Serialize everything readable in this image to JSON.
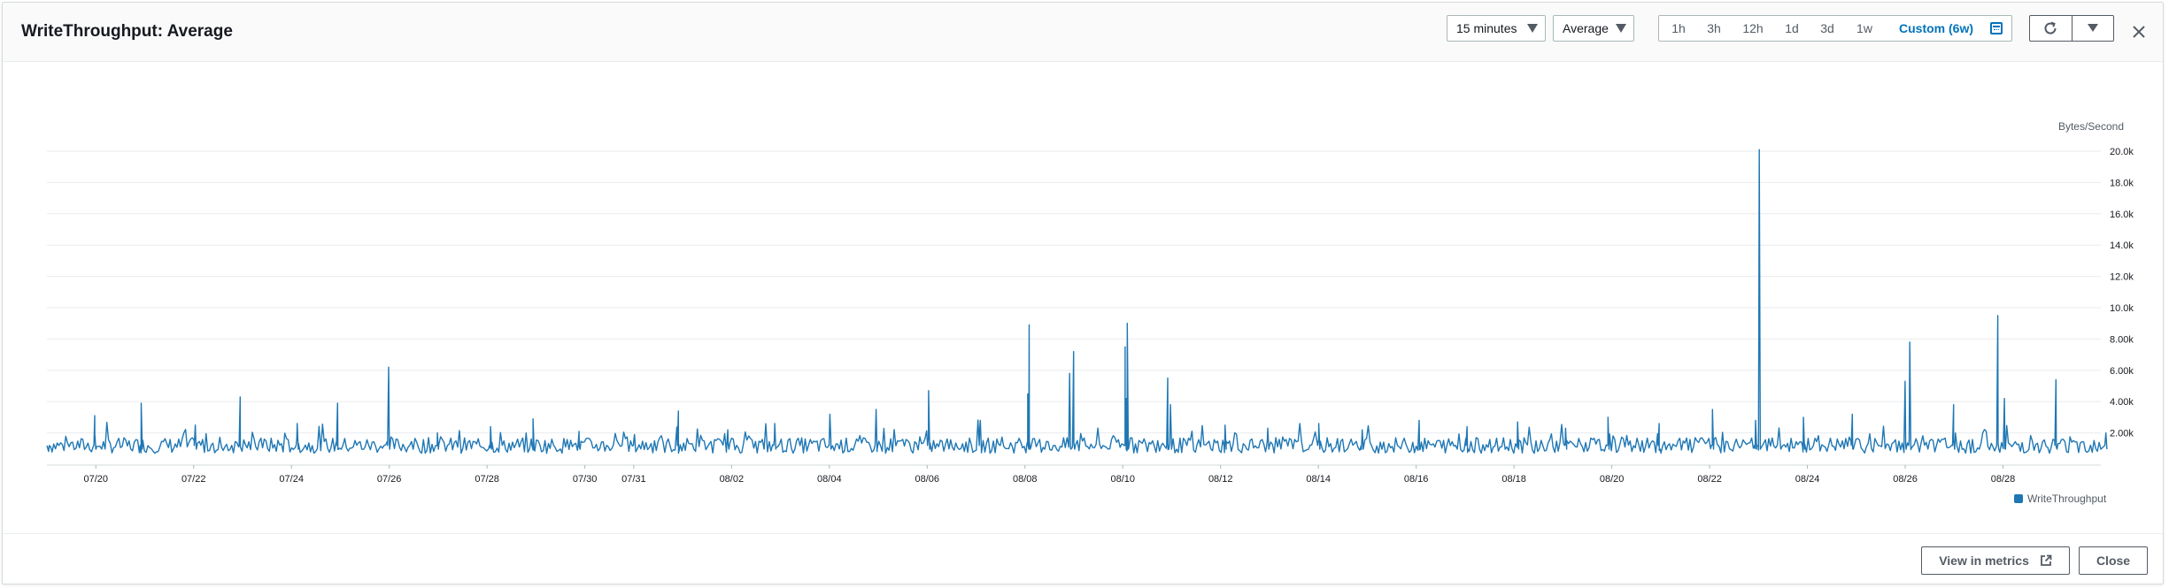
{
  "header": {
    "title": "WriteThroughput: Average",
    "period": "15 minutes",
    "statistic": "Average",
    "ranges": [
      "1h",
      "3h",
      "12h",
      "1d",
      "3d",
      "1w",
      "Custom (6w)"
    ],
    "active_range": "Custom (6w)"
  },
  "footer": {
    "view_in_metrics": "View in metrics",
    "close": "Close"
  },
  "colors": {
    "series": "#1f77b4",
    "accent": "#0073bb"
  },
  "chart_data": {
    "type": "line",
    "ylabel": "Bytes/Second",
    "ylim": [
      0,
      20000
    ],
    "yticks": [
      {
        "value": 2000,
        "label": "2.00k"
      },
      {
        "value": 4000,
        "label": "4.00k"
      },
      {
        "value": 6000,
        "label": "6.00k"
      },
      {
        "value": 8000,
        "label": "8.00k"
      },
      {
        "value": 10000,
        "label": "10.0k"
      },
      {
        "value": 12000,
        "label": "12.0k"
      },
      {
        "value": 14000,
        "label": "14.0k"
      },
      {
        "value": 16000,
        "label": "16.0k"
      },
      {
        "value": 18000,
        "label": "18.0k"
      },
      {
        "value": 20000,
        "label": "20.0k"
      }
    ],
    "xlim": [
      "07-19",
      "08-30"
    ],
    "xticks": [
      "07/20",
      "07/22",
      "07/24",
      "07/26",
      "07/28",
      "07/30",
      "07/31",
      "08/02",
      "08/04",
      "08/06",
      "08/08",
      "08/10",
      "08/12",
      "08/14",
      "08/16",
      "08/18",
      "08/20",
      "08/22",
      "08/24",
      "08/26",
      "08/28"
    ],
    "grid": true,
    "legend": "bottom-right",
    "series": [
      {
        "name": "WriteThroughput",
        "baseline": 1200,
        "points": [
          {
            "x": "07-19",
            "y": 1100
          },
          {
            "x": "07-20",
            "y": 1800
          },
          {
            "x": "07-20",
            "y": 3100
          },
          {
            "x": "07-21",
            "y": 3900
          },
          {
            "x": "07-22",
            "y": 2500
          },
          {
            "x": "07-23",
            "y": 4300
          },
          {
            "x": "07-24",
            "y": 2600
          },
          {
            "x": "07-25",
            "y": 3900
          },
          {
            "x": "07-26",
            "y": 6200
          },
          {
            "x": "07-27",
            "y": 2000
          },
          {
            "x": "07-28",
            "y": 2400
          },
          {
            "x": "07-29",
            "y": 2900
          },
          {
            "x": "07-30",
            "y": 2100
          },
          {
            "x": "07-31",
            "y": 1900
          },
          {
            "x": "08-01",
            "y": 3400
          },
          {
            "x": "08-02",
            "y": 2200
          },
          {
            "x": "08-03",
            "y": 2600
          },
          {
            "x": "08-04",
            "y": 3200
          },
          {
            "x": "08-05",
            "y": 3500
          },
          {
            "x": "08-06",
            "y": 4700
          },
          {
            "x": "08-07",
            "y": 2800
          },
          {
            "x": "08-08",
            "y": 8900
          },
          {
            "x": "08-08",
            "y": 4500
          },
          {
            "x": "08-09",
            "y": 7200
          },
          {
            "x": "08-09",
            "y": 5800
          },
          {
            "x": "08-10",
            "y": 4200
          },
          {
            "x": "08-10",
            "y": 9000
          },
          {
            "x": "08-10",
            "y": 7500
          },
          {
            "x": "08-11",
            "y": 5500
          },
          {
            "x": "08-11",
            "y": 3800
          },
          {
            "x": "08-12",
            "y": 2500
          },
          {
            "x": "08-13",
            "y": 2300
          },
          {
            "x": "08-14",
            "y": 2600
          },
          {
            "x": "08-15",
            "y": 2200
          },
          {
            "x": "08-16",
            "y": 2800
          },
          {
            "x": "08-17",
            "y": 2400
          },
          {
            "x": "08-18",
            "y": 2700
          },
          {
            "x": "08-19",
            "y": 2300
          },
          {
            "x": "08-20",
            "y": 3000
          },
          {
            "x": "08-21",
            "y": 2600
          },
          {
            "x": "08-22",
            "y": 3500
          },
          {
            "x": "08-23",
            "y": 20100
          },
          {
            "x": "08-23",
            "y": 2800
          },
          {
            "x": "08-24",
            "y": 3000
          },
          {
            "x": "08-25",
            "y": 3200
          },
          {
            "x": "08-26",
            "y": 7800
          },
          {
            "x": "08-26",
            "y": 5300
          },
          {
            "x": "08-27",
            "y": 3800
          },
          {
            "x": "08-28",
            "y": 4200
          },
          {
            "x": "08-28",
            "y": 9500
          },
          {
            "x": "08-29",
            "y": 5400
          },
          {
            "x": "08-30",
            "y": 2000
          }
        ]
      }
    ]
  }
}
